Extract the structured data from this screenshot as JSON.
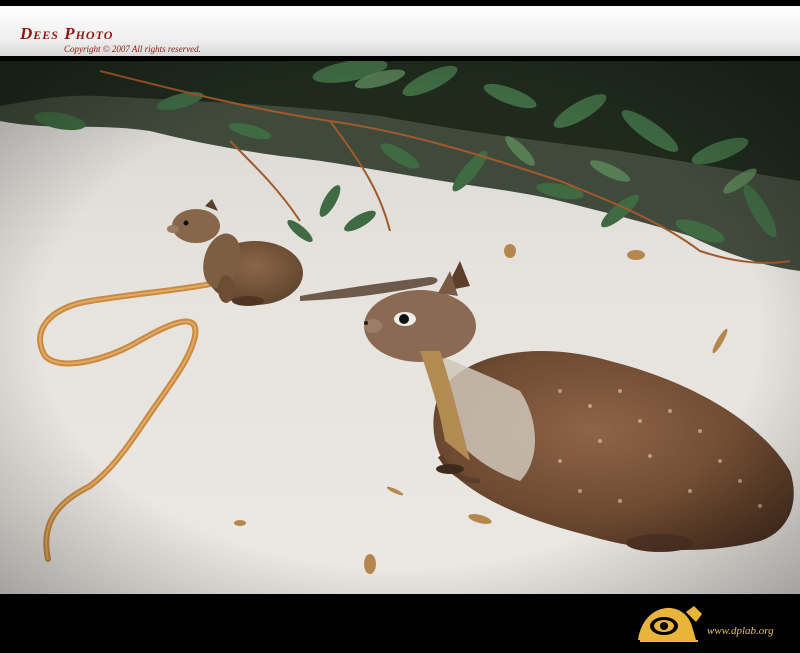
{
  "header": {
    "title": "Dees Photo",
    "copyright": "Copyright © 2007 All rights reserved."
  },
  "photo": {
    "subject": "two ground squirrels on sand with shrub",
    "colors": {
      "sand": "#e7e4df",
      "fur": "#7a5236",
      "leaves": "#3f5e3b",
      "root": "#c98a40"
    }
  },
  "footer": {
    "logo_icon": "dplab-eye-logo-icon",
    "site": "www.dplab.org",
    "accent": "#e8b53a"
  }
}
